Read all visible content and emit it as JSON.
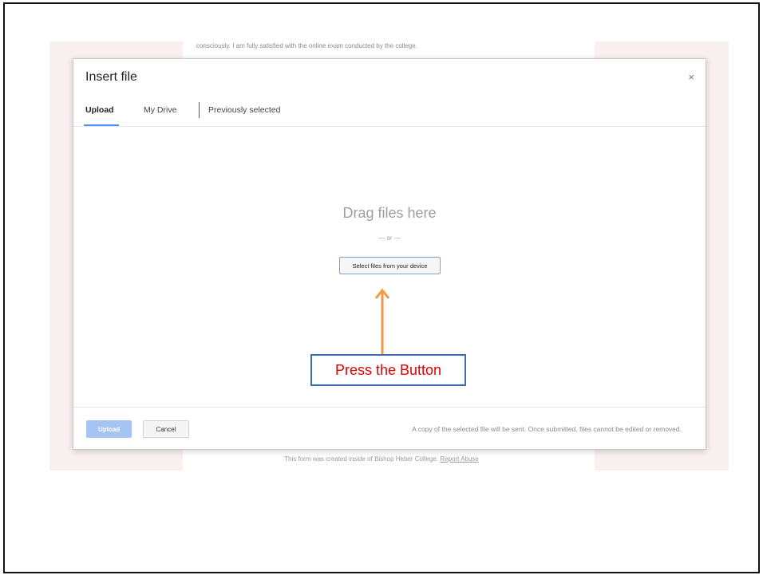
{
  "background": {
    "top_text": "consciously. I am fully satisfied with the online exam conducted by the college.",
    "footer_text": "This form was created inside of Bishop Heber College.",
    "footer_link": "Report Abuse"
  },
  "dialog": {
    "title": "Insert file",
    "close_icon": "×",
    "tabs": [
      {
        "label": "Upload",
        "active": true
      },
      {
        "label": "My Drive",
        "active": false
      },
      {
        "label": "Previously selected",
        "active": false
      }
    ],
    "drag_text": "Drag files here",
    "or_text": "— or —",
    "select_button": "Select files from your device",
    "upload_button": "Upload",
    "cancel_button": "Cancel",
    "footer_note": "A copy of the selected file will be sent. Once submitted, files cannot be edited or removed."
  },
  "annotation": {
    "callout_text": "Press the Button",
    "callout_color": "#e00000",
    "arrow_color": "#f79646",
    "box_border_color": "#3b6eb0"
  },
  "colors": {
    "accent": "#4d90fe",
    "upload_disabled": "#a6c4f3",
    "page_background": "#f9f1f0"
  }
}
